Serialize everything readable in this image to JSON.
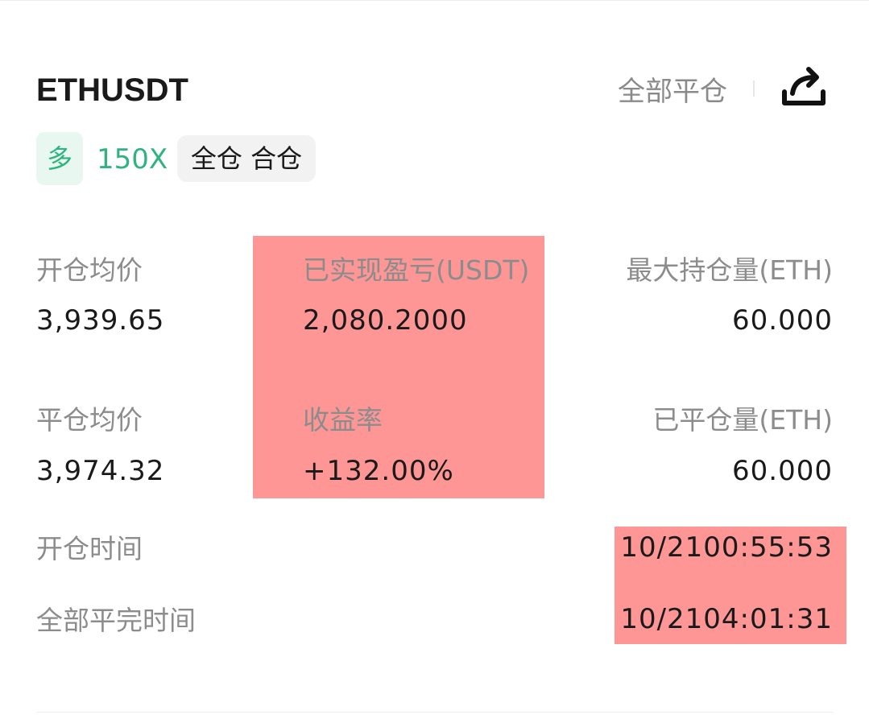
{
  "header": {
    "symbol": "ETHUSDT",
    "close_all_label": "全部平仓",
    "share_icon": "share-icon"
  },
  "tags": {
    "direction": "多",
    "leverage": "150X",
    "margin_mode": "全仓 合仓"
  },
  "stats": {
    "open_avg_price_label": "开仓均价",
    "open_avg_price_value": "3,939.65",
    "realized_pnl_label": "已实现盈亏(USDT)",
    "realized_pnl_value": "2,080.2000",
    "max_position_label": "最大持仓量(ETH)",
    "max_position_value": "60.000",
    "close_avg_price_label": "平仓均价",
    "close_avg_price_value": "3,974.32",
    "roi_label": "收益率",
    "roi_value": "+132.00%",
    "closed_qty_label": "已平仓量(ETH)",
    "closed_qty_value": "60.000"
  },
  "times": {
    "open_time_label": "开仓时间",
    "open_time_value": "10/2100:55:53",
    "full_close_time_label": "全部平完时间",
    "full_close_time_value": "10/2104:01:31"
  },
  "colors": {
    "long_green": "#2fb381",
    "redaction_overlay": "#fe9696",
    "label_gray": "#8c8c8c",
    "text_dark": "#1a1a1a"
  }
}
